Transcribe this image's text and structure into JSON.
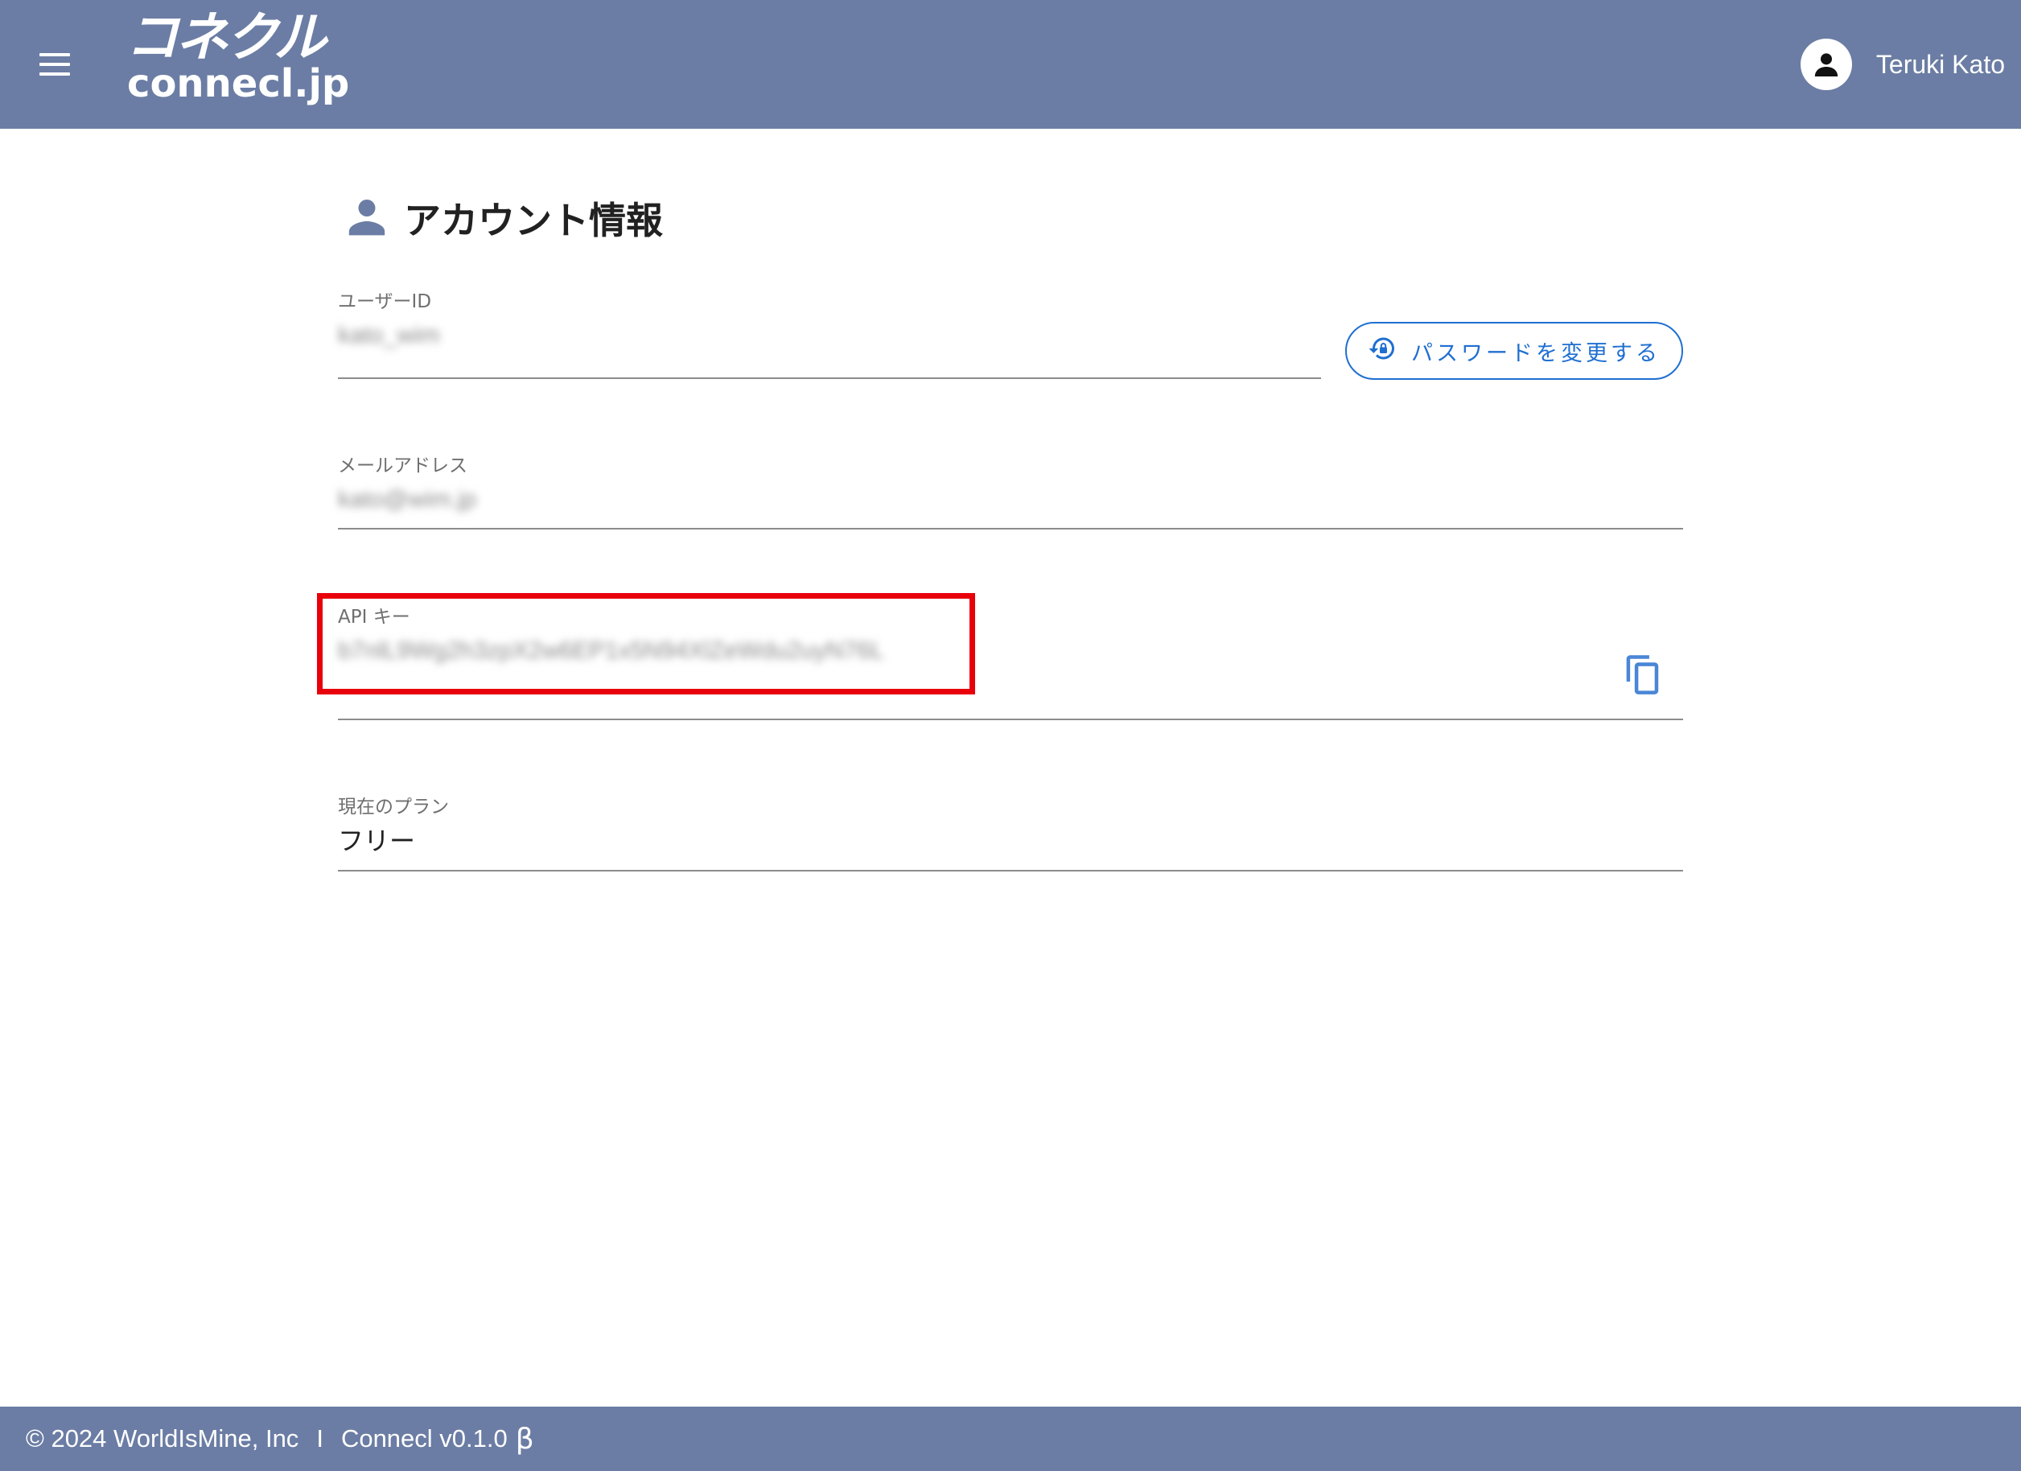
{
  "header": {
    "logo_jp": "コネクル",
    "logo_en": "connecl.jp",
    "user_name": "Teruki Kato"
  },
  "page": {
    "title": "アカウント情報"
  },
  "fields": {
    "user_id": {
      "label": "ユーザーID",
      "value": "kato_wim"
    },
    "email": {
      "label": "メールアドレス",
      "value": "kato@wim.jp"
    },
    "api_key": {
      "label": "API キー",
      "value": "b7nlL9Wg2h3zpX2w6EP1x5N94XlZeWdu2uyN76L"
    },
    "plan": {
      "label": "現在のプラン",
      "value": "フリー"
    }
  },
  "buttons": {
    "change_password": "パスワードを変更する"
  },
  "footer": {
    "copyright": "© 2024 WorldIsMine, Inc",
    "separator": "I",
    "version": "Connecl v0.1.0",
    "beta": "β"
  },
  "colors": {
    "header_bg": "#6b7da4",
    "accent": "#1f6fd1",
    "highlight": "#e8000b"
  },
  "icons": {
    "menu": "hamburger-menu-icon",
    "user": "account-circle-icon",
    "title": "person-icon",
    "password": "lock-reset-icon",
    "copy": "copy-icon"
  }
}
